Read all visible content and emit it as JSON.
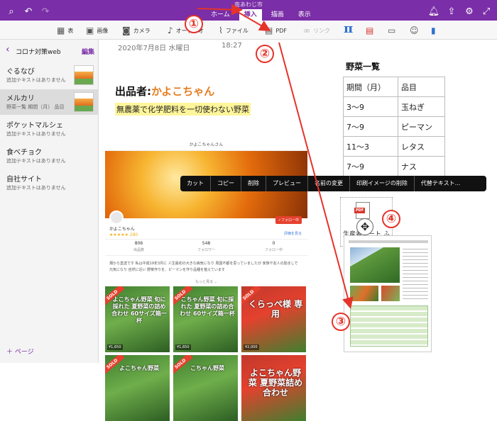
{
  "window": {
    "title": "南あわじ市"
  },
  "ribbon_tabs": [
    "ホーム",
    "挿入",
    "描画",
    "表示"
  ],
  "ribbon_active": "挿入",
  "toolbar": {
    "table": "表",
    "image": "画像",
    "camera": "カメラ",
    "audio": "オーディオ",
    "file": "ファイル",
    "pdf": "PDF",
    "link": "リンク",
    "math": "π"
  },
  "sidebar": {
    "back": "‹",
    "section_title": "コロナ対策web",
    "edit": "編集",
    "pages": [
      {
        "name": "ぐるなび",
        "preview": "追加テキストはありません"
      },
      {
        "name": "メルカリ",
        "preview": "野菜一覧 期間（月） 品目"
      },
      {
        "name": "ポケットマルシェ",
        "preview": "追加テキストはありません"
      },
      {
        "name": "食べチョク",
        "preview": "追加テキストはありません"
      },
      {
        "name": "自社サイト",
        "preview": "追加テキストはありません"
      }
    ],
    "add_page": "＋ ページ"
  },
  "note": {
    "date": "2020年7月8日 水曜日",
    "time": "18:27",
    "seller_prefix": "出品者:",
    "seller_name": "かよこちゃん",
    "highlight": "無農薬で化学肥料を一切使わない野菜"
  },
  "embed": {
    "header": "かよこちゃんさん",
    "user": "かよこちゃん",
    "stars": "★★★★★ 280",
    "follow": "✓フォロー中",
    "share": "評価を見る",
    "stats": [
      {
        "value": "806",
        "label": "出品数"
      },
      {
        "value": "548",
        "label": "フォロワー"
      },
      {
        "value": "0",
        "label": "フォロー中"
      }
    ],
    "description": "畑から直送です 私は平成19年3月に 人生最初の大きな病気になり 周囲不都を思っていましたが 家族や友人の励ましで 元気になり 自然に近い 野菜作りを、ピーマンを作り品種を植えています",
    "more": "もっと見る ⌄",
    "items": [
      {
        "sold": "SOLD",
        "caption": "よこちゃん野菜 旬に採れた 夏野菜の詰め合わせ 60サイズ箱一杯",
        "price": "¥1,650"
      },
      {
        "sold": "SOLD",
        "caption": "こちゃん野菜 旬に採れた 夏野菜の詰め合わせ 60サイズ箱一杯",
        "price": "¥1,650"
      },
      {
        "sold": "SOLD",
        "caption": "くらっぺ様 専用",
        "price": "¥2,000"
      },
      {
        "sold": "SOLD",
        "caption": "よこちゃん野菜",
        "price": ""
      },
      {
        "sold": "SOLD",
        "caption": "こちゃん野菜",
        "price": ""
      },
      {
        "sold": "",
        "caption": "よこちゃん野菜 夏野菜詰め合わせ",
        "price": ""
      }
    ]
  },
  "veg_table": {
    "title": "野菜一覧",
    "headers": [
      "期間（月）",
      "品目"
    ],
    "rows": [
      [
        "3〜9",
        "玉ねぎ"
      ],
      [
        "7〜9",
        "ピーマン"
      ],
      [
        "11〜3",
        "レタス"
      ],
      [
        "7〜9",
        "ナス"
      ]
    ]
  },
  "pdf_file": {
    "badge": "PDF",
    "name": "生産者シート ふきの"
  },
  "context_menu": [
    "カット",
    "コピー",
    "削除",
    "プレビュー",
    "名前の変更",
    "印刷イメージの削除",
    "代替テキスト..."
  ],
  "callouts": [
    "①",
    "②",
    "③",
    "④"
  ],
  "colors": {
    "accent": "#7a2ea7",
    "annotation": "#e5332a",
    "highlight": "#fff59a"
  }
}
